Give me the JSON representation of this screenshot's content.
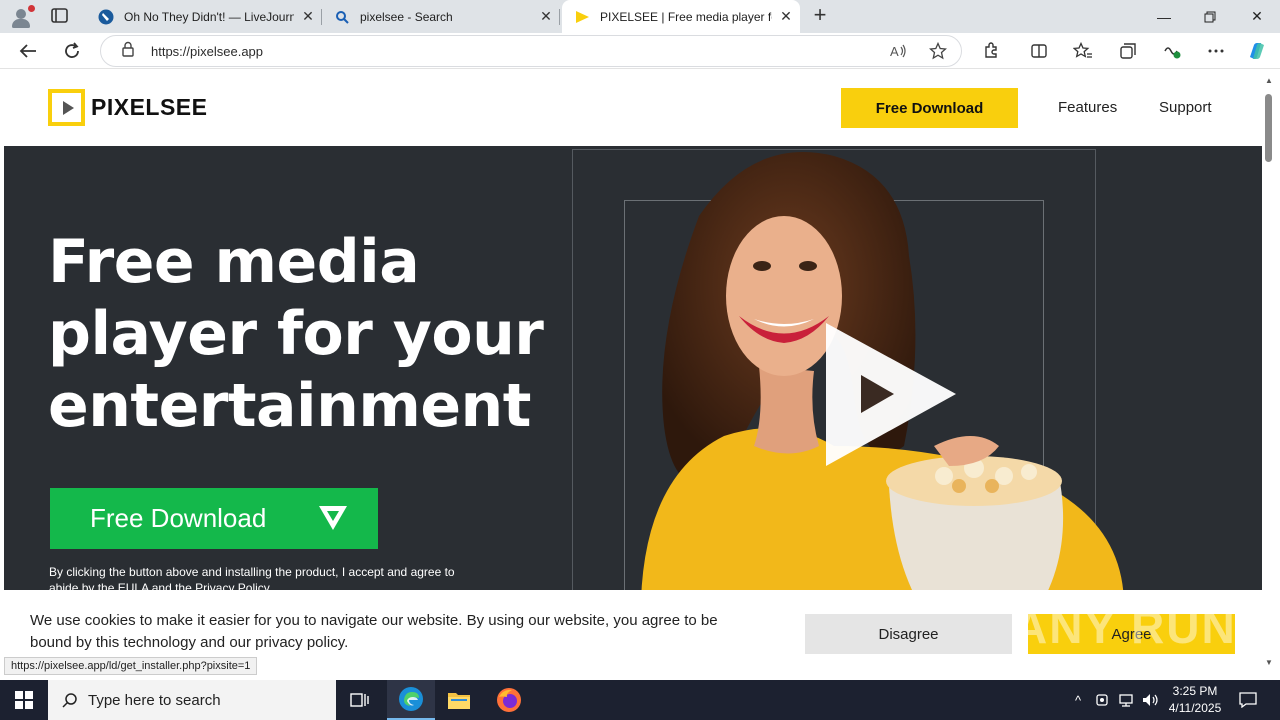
{
  "browser": {
    "tabs": [
      {
        "title": "Oh No They Didn't! — LiveJournal",
        "active": false
      },
      {
        "title": "pixelsee - Search",
        "active": false
      },
      {
        "title": "PIXELSEE | Free media player for your entertainment",
        "active": true
      }
    ],
    "url": "https://pixelsee.app",
    "status_url": "https://pixelsee.app/ld/get_installer.php?pixsite=1"
  },
  "site": {
    "logo": "PIXELSEE",
    "header_download": "Free Download",
    "nav": [
      "Features",
      "Support"
    ],
    "hero_title": "Free media player for your entertainment",
    "hero_download": "Free Download",
    "legal": "By clicking the button above and installing the product, I accept and agree to abide by the EULA and the Privacy Policy"
  },
  "cookie": {
    "text": "We use cookies to make it easier for you to navigate our website. By using our website, you agree to be bound by this technology and our privacy policy.",
    "disagree": "Disagree",
    "agree": "Agree"
  },
  "watermark": "ANY RUN",
  "taskbar": {
    "search_placeholder": "Type here to search",
    "time": "3:25 PM",
    "date": "4/11/2025"
  },
  "colors": {
    "brand_yellow": "#f9cf0d",
    "download_green": "#14b84b",
    "hero_bg": "#2a2e33"
  }
}
